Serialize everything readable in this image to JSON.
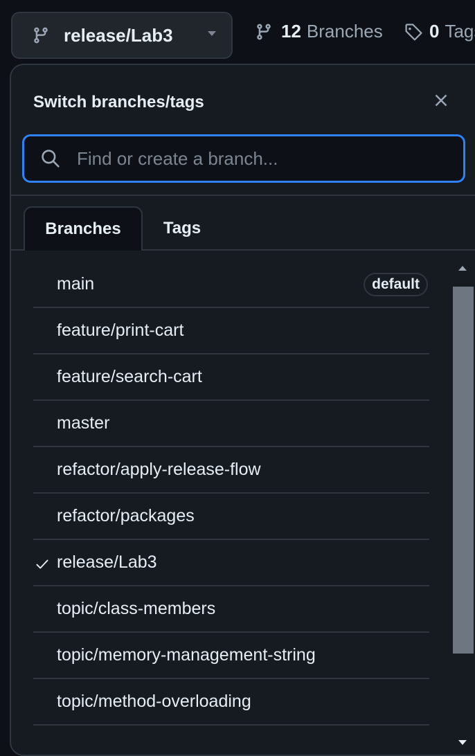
{
  "topbar": {
    "current_branch": "release/Lab3",
    "branches_count": "12",
    "branches_label": "Branches",
    "tags_count": "0",
    "tags_label": "Tags"
  },
  "popover": {
    "title": "Switch branches/tags",
    "search": {
      "placeholder": "Find or create a branch..."
    },
    "tabs": [
      {
        "label": "Branches",
        "active": true
      },
      {
        "label": "Tags",
        "active": false
      }
    ],
    "branches": [
      {
        "name": "main",
        "badge": "default",
        "selected": false
      },
      {
        "name": "feature/print-cart",
        "selected": false
      },
      {
        "name": "feature/search-cart",
        "selected": false
      },
      {
        "name": "master",
        "selected": false
      },
      {
        "name": "refactor/apply-release-flow",
        "selected": false
      },
      {
        "name": "refactor/packages",
        "selected": false
      },
      {
        "name": "release/Lab3",
        "selected": true
      },
      {
        "name": "topic/class-members",
        "selected": false
      },
      {
        "name": "topic/memory-management-string",
        "selected": false
      },
      {
        "name": "topic/method-overloading",
        "selected": false
      }
    ]
  },
  "colors": {
    "background": "#0d1117",
    "panel": "#161b22",
    "border": "#30363d",
    "focus_ring": "#2f81f7",
    "text_primary": "#e6edf3",
    "text_muted": "#9da7b3"
  },
  "icons": {
    "branch": "git-branch-icon",
    "tag": "tag-icon",
    "search": "search-icon",
    "close": "close-icon",
    "check": "check-icon"
  }
}
